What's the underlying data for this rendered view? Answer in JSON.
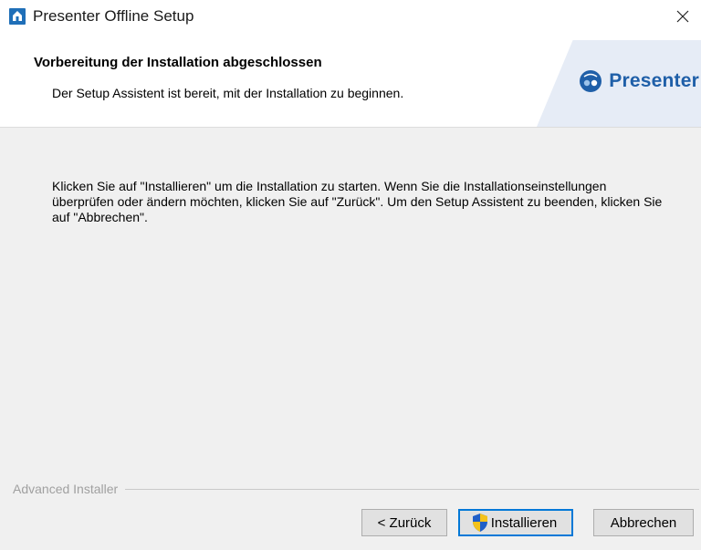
{
  "window": {
    "title": "Presenter Offline Setup",
    "app_icon": "house-icon",
    "close_icon": "close-icon"
  },
  "header": {
    "title": "Vorbereitung der Installation abgeschlossen",
    "subtitle": "Der Setup Assistent ist bereit, mit der Installation zu beginnen.",
    "logo_text": "Presenter",
    "logo_icon": "presenter-logo-icon"
  },
  "body": {
    "message": "Klicken Sie auf \"Installieren\" um die Installation zu starten. Wenn Sie die Installationseinstellungen überprüfen oder ändern möchten, klicken Sie auf \"Zurück\". Um den Setup Assistent zu beenden, klicken Sie auf \"Abbrechen\"."
  },
  "footer": {
    "brand": "Advanced Installer",
    "buttons": {
      "back": "< Zurück",
      "install": "Installieren",
      "cancel": "Abbrechen"
    },
    "install_icon": "uac-shield-icon"
  },
  "colors": {
    "accent": "#0078d7",
    "logo_blue": "#1f5fa8",
    "window_bg": "#f0f0f0"
  }
}
